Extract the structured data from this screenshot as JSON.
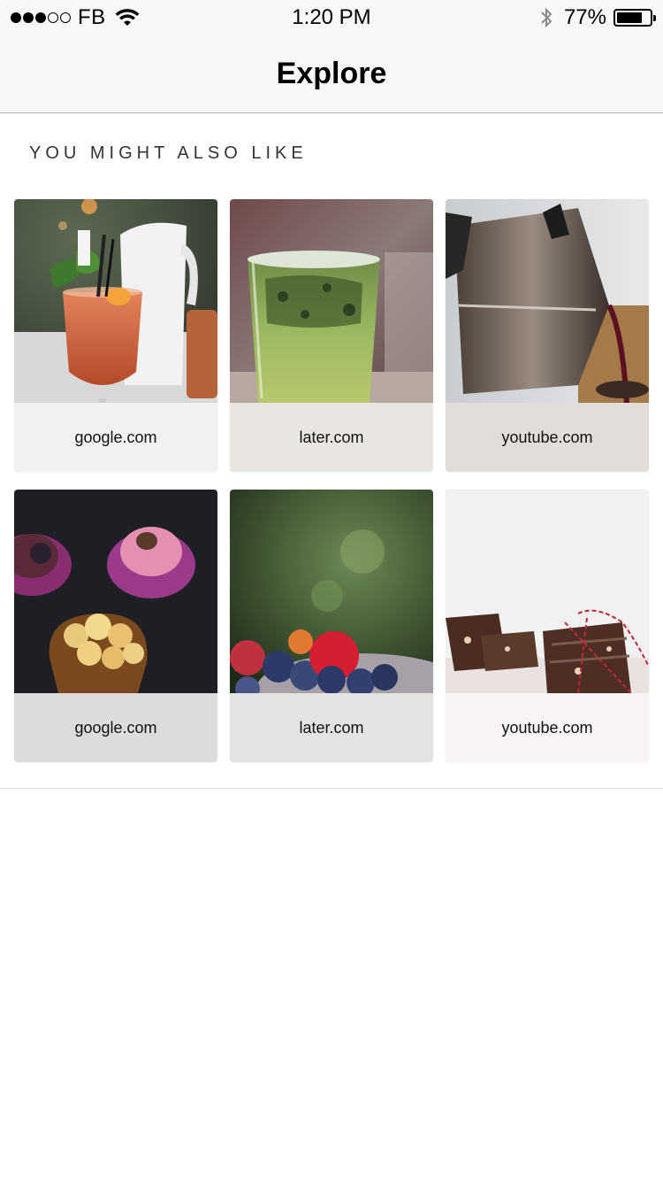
{
  "status_bar": {
    "signal_dots": "●●●○○",
    "carrier": "FB",
    "time": "1:20 PM",
    "battery_percent": "77%",
    "battery_level": 0.77
  },
  "nav": {
    "title": "Explore"
  },
  "section": {
    "title": "YOU MIGHT ALSO LIKE"
  },
  "cards": [
    {
      "label": "google.com",
      "image": "cocktail-drink-photo",
      "caption_tint": "#f3f1ef"
    },
    {
      "label": "later.com",
      "image": "green-mojito-photo",
      "caption_tint": "#e9e6e2"
    },
    {
      "label": "youtube.com",
      "image": "moka-pot-coffee-photo",
      "caption_tint": "#e2ddd8"
    },
    {
      "label": "google.com",
      "image": "cupcakes-photo",
      "caption_tint": "#dcdcdc"
    },
    {
      "label": "later.com",
      "image": "berries-bowl-photo",
      "caption_tint": "#e3e3e1"
    },
    {
      "label": "youtube.com",
      "image": "chocolate-bark-photo",
      "caption_tint": "#f7f4f3"
    }
  ]
}
